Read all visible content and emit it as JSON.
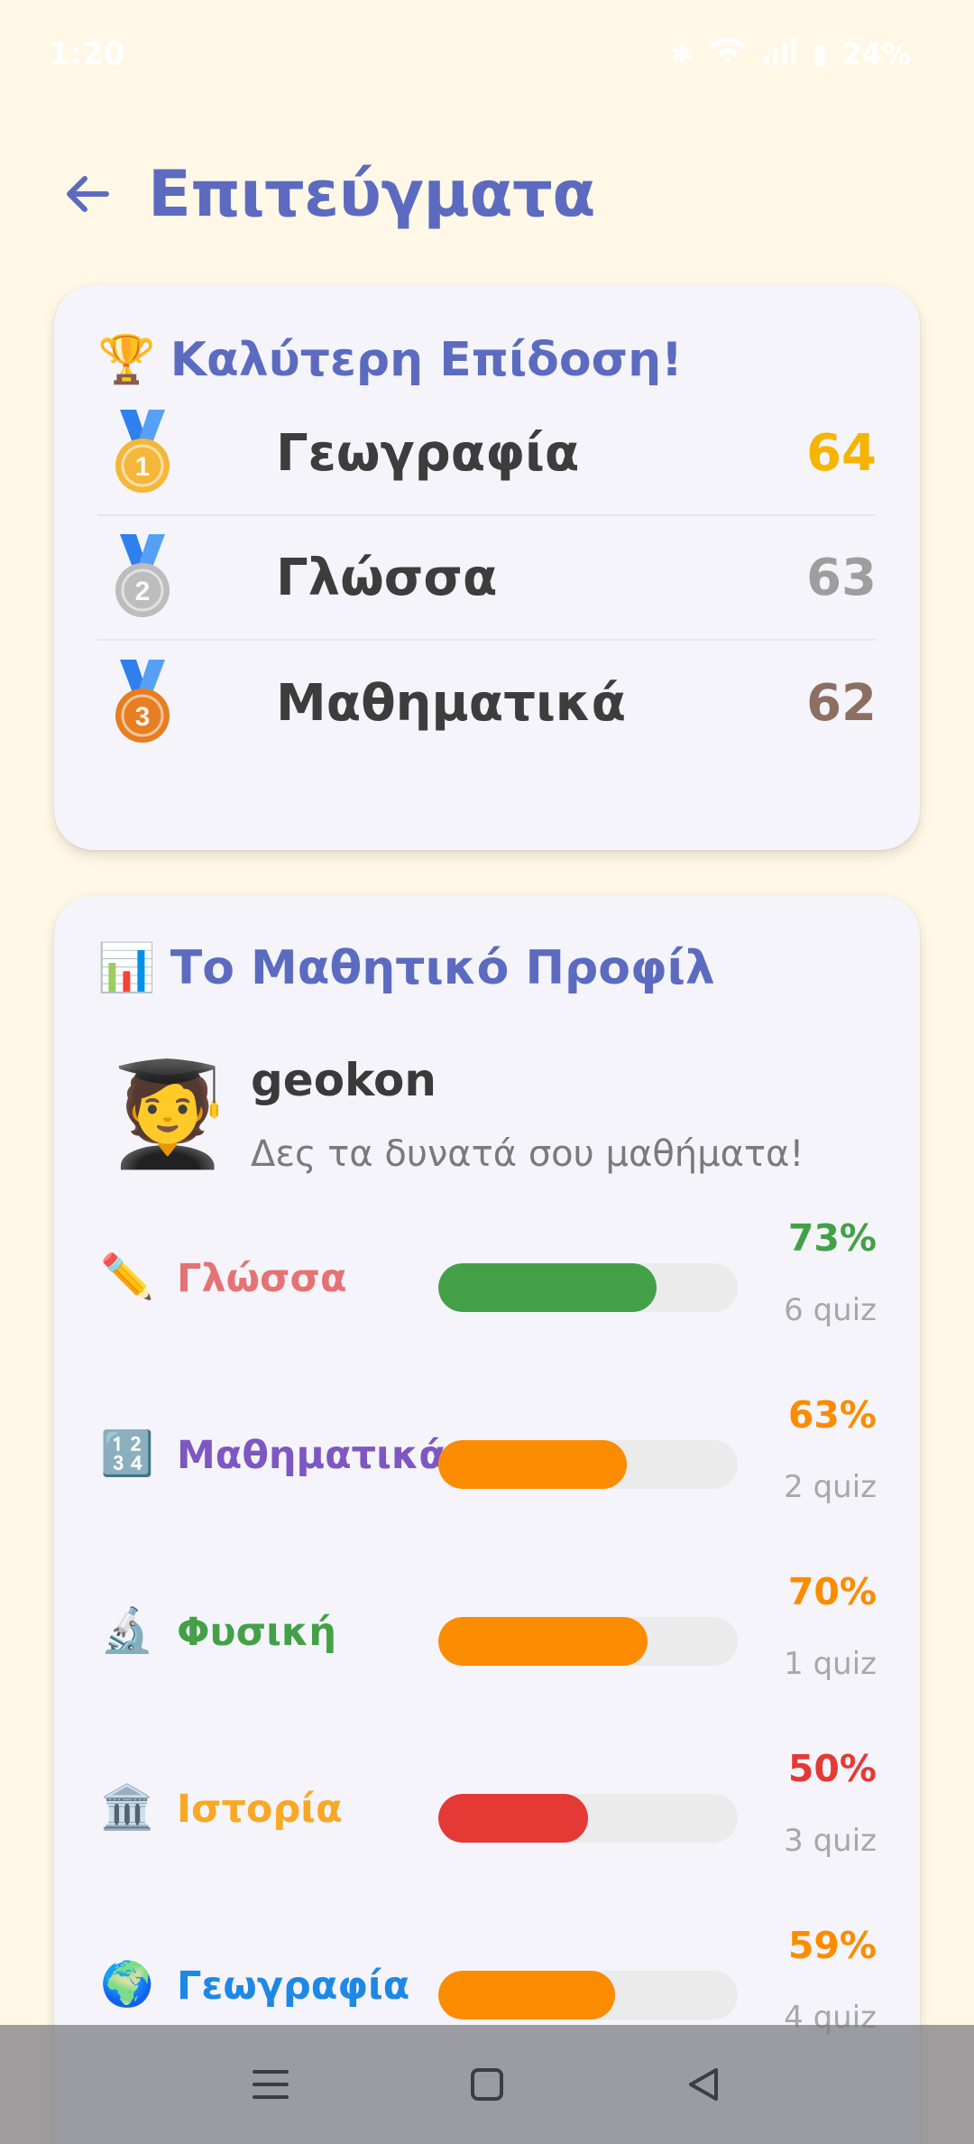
{
  "status_bar": {
    "time": "1:20",
    "battery": "24%",
    "icons": [
      "bluetooth-icon",
      "data-speed-icon",
      "wifi-icon",
      "volte-icon",
      "signal-icon",
      "battery-icon"
    ]
  },
  "header": {
    "title": "Επιτεύγματα",
    "back_icon": "arrow-left-icon"
  },
  "best_scores": {
    "emoji": "🏆",
    "title": "Καλύτερη Επίδοση!",
    "items": [
      {
        "rank": "1",
        "subject": "Γεωγραφία",
        "score": "64",
        "color": "#f5b400",
        "medal_color": "#f5b73b"
      },
      {
        "rank": "2",
        "subject": "Γλώσσα",
        "score": "63",
        "color": "#9e9e9e",
        "medal_color": "#bdbdbd"
      },
      {
        "rank": "3",
        "subject": "Μαθηματικά",
        "score": "62",
        "color": "#8d6e63",
        "medal_color": "#e67e22"
      }
    ]
  },
  "profile": {
    "emoji": "📊",
    "title": "Το Μαθητικό Προφίλ",
    "avatar": "🧑‍🎓",
    "username": "geokon",
    "tagline": "Δες τα δυνατά σου μαθήματα!",
    "subjects": [
      {
        "emoji": "✏️",
        "name": "Γλώσσα",
        "name_color": "#e57373",
        "percent_label": "73%",
        "fraction": 0.73,
        "bar_color": "#43a047",
        "pct_color": "#43a047",
        "quiz": "6 quiz"
      },
      {
        "emoji": "🔢",
        "name": "Μαθηματικά",
        "name_color": "#7e57c2",
        "percent_label": "63%",
        "fraction": 0.63,
        "bar_color": "#fb8c00",
        "pct_color": "#fb8c00",
        "quiz": "2 quiz"
      },
      {
        "emoji": "🔬",
        "name": "Φυσική",
        "name_color": "#43a047",
        "percent_label": "70%",
        "fraction": 0.7,
        "bar_color": "#fb8c00",
        "pct_color": "#fb8c00",
        "quiz": "1 quiz"
      },
      {
        "emoji": "🏛️",
        "name": "Ιστορία",
        "name_color": "#f9a825",
        "percent_label": "50%",
        "fraction": 0.5,
        "bar_color": "#e53935",
        "pct_color": "#e53935",
        "quiz": "3 quiz"
      },
      {
        "emoji": "🌍",
        "name": "Γεωγραφία",
        "name_color": "#1e88e5",
        "percent_label": "59%",
        "fraction": 0.59,
        "bar_color": "#fb8c00",
        "pct_color": "#fb8c00",
        "quiz": "4 quiz"
      }
    ]
  },
  "nav_bar": {
    "buttons": [
      "menu-icon",
      "home-icon",
      "back-icon"
    ]
  }
}
